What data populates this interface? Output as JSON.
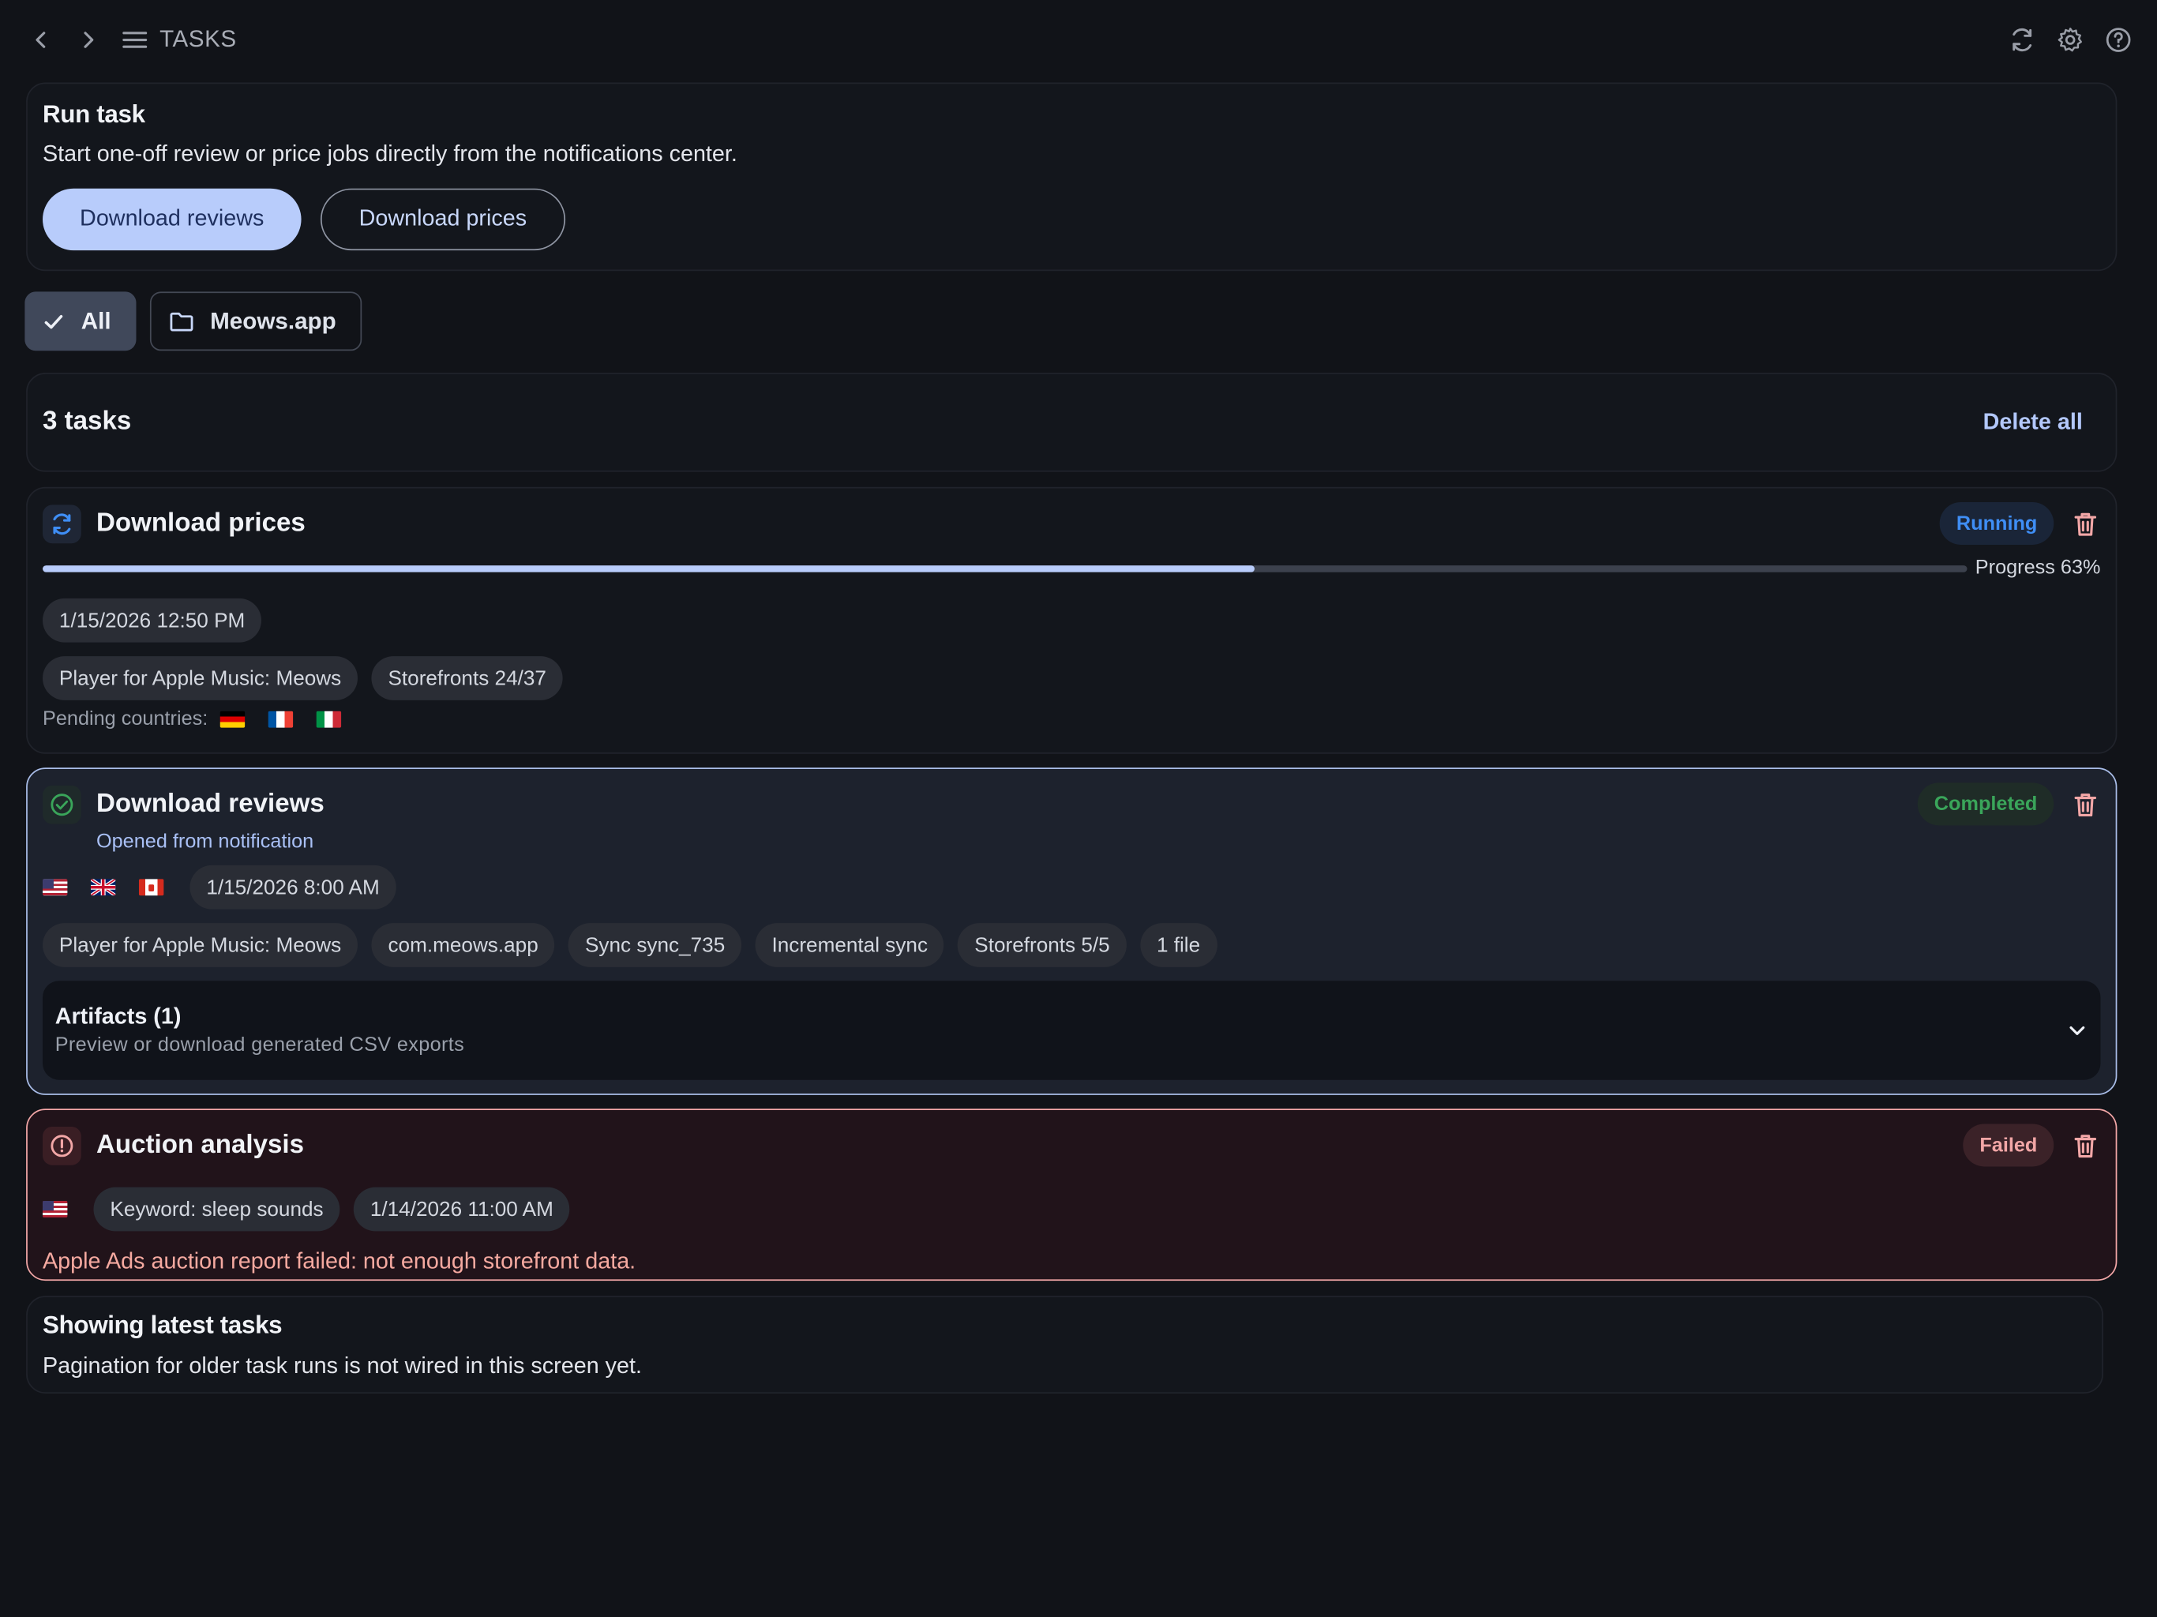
{
  "header": {
    "title": "TASKS",
    "icons": [
      "chevron-left-icon",
      "chevron-right-icon",
      "menu-icon",
      "refresh-icon",
      "gear-icon",
      "help-icon"
    ]
  },
  "run_task": {
    "heading": "Run task",
    "description": "Start one-off review or price jobs directly from the notifications center.",
    "primary_button": "Download reviews",
    "secondary_button": "Download prices"
  },
  "filters": [
    {
      "label": "All",
      "selected": true,
      "icon": "check-icon"
    },
    {
      "label": "Meows.app",
      "selected": false,
      "icon": "folder-icon"
    }
  ],
  "tasks_bar": {
    "count_label": "3 tasks",
    "delete_all": "Delete all"
  },
  "tasks": [
    {
      "title": "Download prices",
      "status": "Running",
      "status_color": "#3f8ef5",
      "progress_percent": 63,
      "progress_label": "Progress 63%",
      "date": "1/15/2026 12:50 PM",
      "tags": [
        "Player for Apple Music: Meows",
        "Storefronts 24/37"
      ],
      "pending_label": "Pending countries:",
      "pending_flags": [
        "DE",
        "FR",
        "IT"
      ]
    },
    {
      "title": "Download reviews",
      "subtitle": "Opened from notification",
      "status": "Completed",
      "status_color": "#3aa55a",
      "flags": [
        "US",
        "GB",
        "CA"
      ],
      "date": "1/15/2026 8:00 AM",
      "tags": [
        "Player for Apple Music: Meows",
        "com.meows.app",
        "Sync sync_735",
        "Incremental sync",
        "Storefronts 5/5",
        "1 file"
      ],
      "artifacts_title": "Artifacts (1)",
      "artifacts_subtitle": "Preview or download generated CSV exports"
    },
    {
      "title": "Auction analysis",
      "status": "Failed",
      "status_color": "#f2a6a6",
      "flags": [
        "US"
      ],
      "tags": [
        "Keyword: sleep sounds",
        "1/14/2026 11:00 AM"
      ],
      "error": "Apple Ads auction report failed: not enough storefront data."
    }
  ],
  "footer": {
    "heading": "Showing latest tasks",
    "text": "Pagination for older task runs is not wired in this screen yet."
  }
}
